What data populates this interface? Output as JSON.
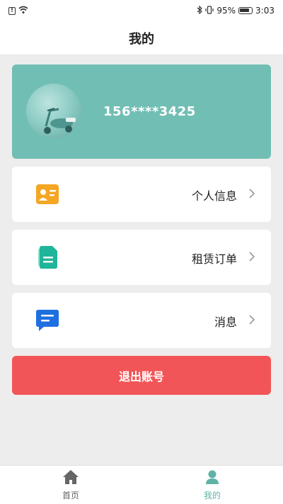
{
  "status_bar": {
    "battery": "95%",
    "time": "3:03"
  },
  "header": {
    "title": "我的"
  },
  "profile": {
    "phone": "156****3425"
  },
  "menu": [
    {
      "label": "个人信息",
      "icon": "id-card-icon",
      "color": "#f5a623"
    },
    {
      "label": "租赁订单",
      "icon": "document-icon",
      "color": "#1fb59a"
    },
    {
      "label": "消息",
      "icon": "message-icon",
      "color": "#1e6fe0"
    }
  ],
  "logout": {
    "label": "退出账号"
  },
  "tab_bar": {
    "tabs": [
      {
        "label": "首页",
        "icon": "home-icon"
      },
      {
        "label": "我的",
        "icon": "user-icon",
        "active": true
      }
    ]
  },
  "colors": {
    "card": "#71beb4",
    "logout": "#f25557",
    "active_tab": "#5fb3a6"
  }
}
